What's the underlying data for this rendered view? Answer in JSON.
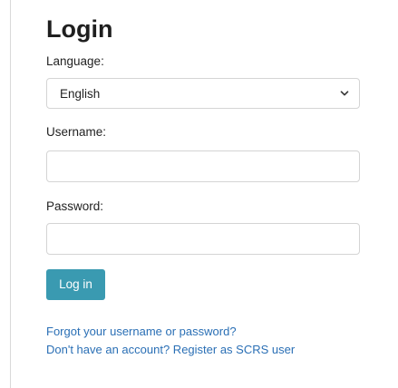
{
  "page": {
    "title": "Login"
  },
  "form": {
    "language": {
      "label": "Language:",
      "selected": "English"
    },
    "username": {
      "label": "Username:",
      "value": "",
      "placeholder": ""
    },
    "password": {
      "label": "Password:",
      "value": "",
      "placeholder": ""
    },
    "submit_label": "Log in"
  },
  "links": {
    "forgot": "Forgot your username or password?",
    "register": "Don't have an account? Register as SCRS user"
  },
  "colors": {
    "primary_button": "#3a9ab1",
    "link": "#2a6fb5",
    "border": "#d4d4d4"
  },
  "icons": {
    "select_arrow": "chevron-down-icon"
  }
}
